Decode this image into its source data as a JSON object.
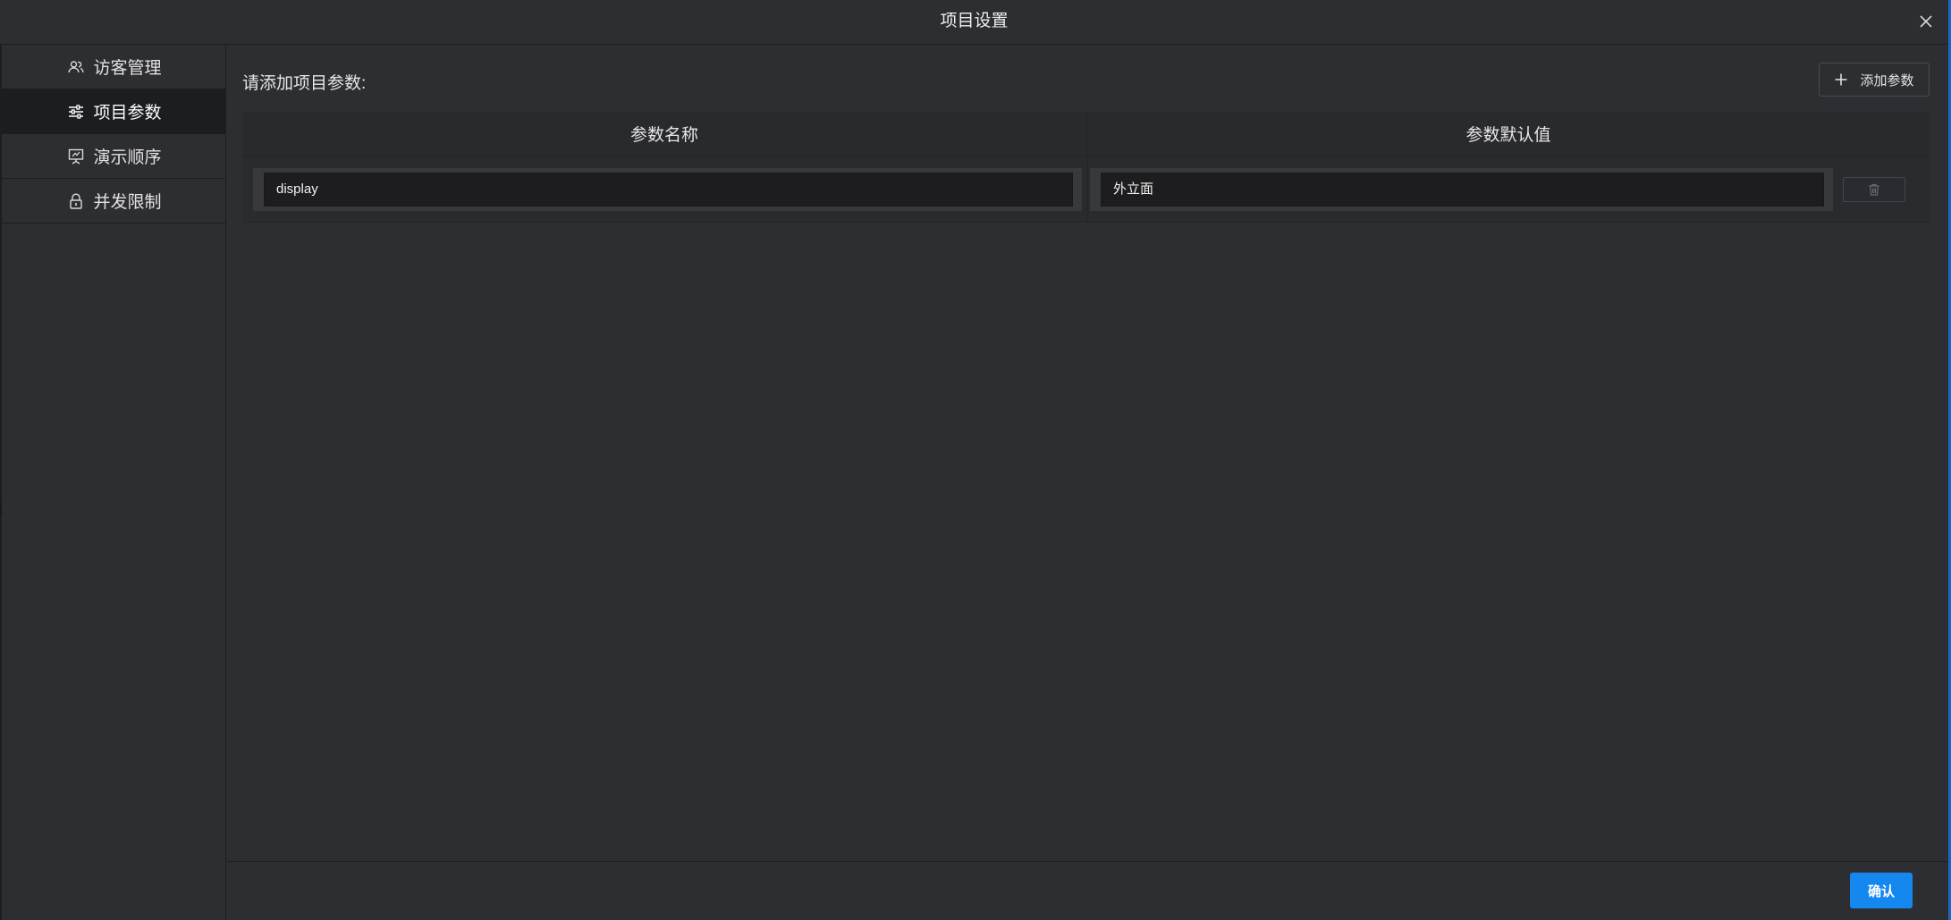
{
  "dialog": {
    "title": "项目设置",
    "close_icon": "close-icon"
  },
  "sidebar": {
    "items": [
      {
        "label": "访客管理",
        "icon": "users-icon",
        "active": false
      },
      {
        "label": "项目参数",
        "icon": "sliders-icon",
        "active": true
      },
      {
        "label": "演示顺序",
        "icon": "presentation-icon",
        "active": false
      },
      {
        "label": "并发限制",
        "icon": "lock-icon",
        "active": false
      }
    ]
  },
  "main": {
    "heading": "请添加项目参数:",
    "add_button_label": "添加参数",
    "table": {
      "columns": [
        "参数名称",
        "参数默认值"
      ],
      "rows": [
        {
          "name": "display",
          "default_value": "外立面"
        }
      ]
    }
  },
  "footer": {
    "confirm_label": "确认"
  },
  "colors": {
    "background": "#2d2e32",
    "active_nav": "#1c1d20",
    "input_bg": "#1d1d1f",
    "accent": "#1588f0"
  }
}
